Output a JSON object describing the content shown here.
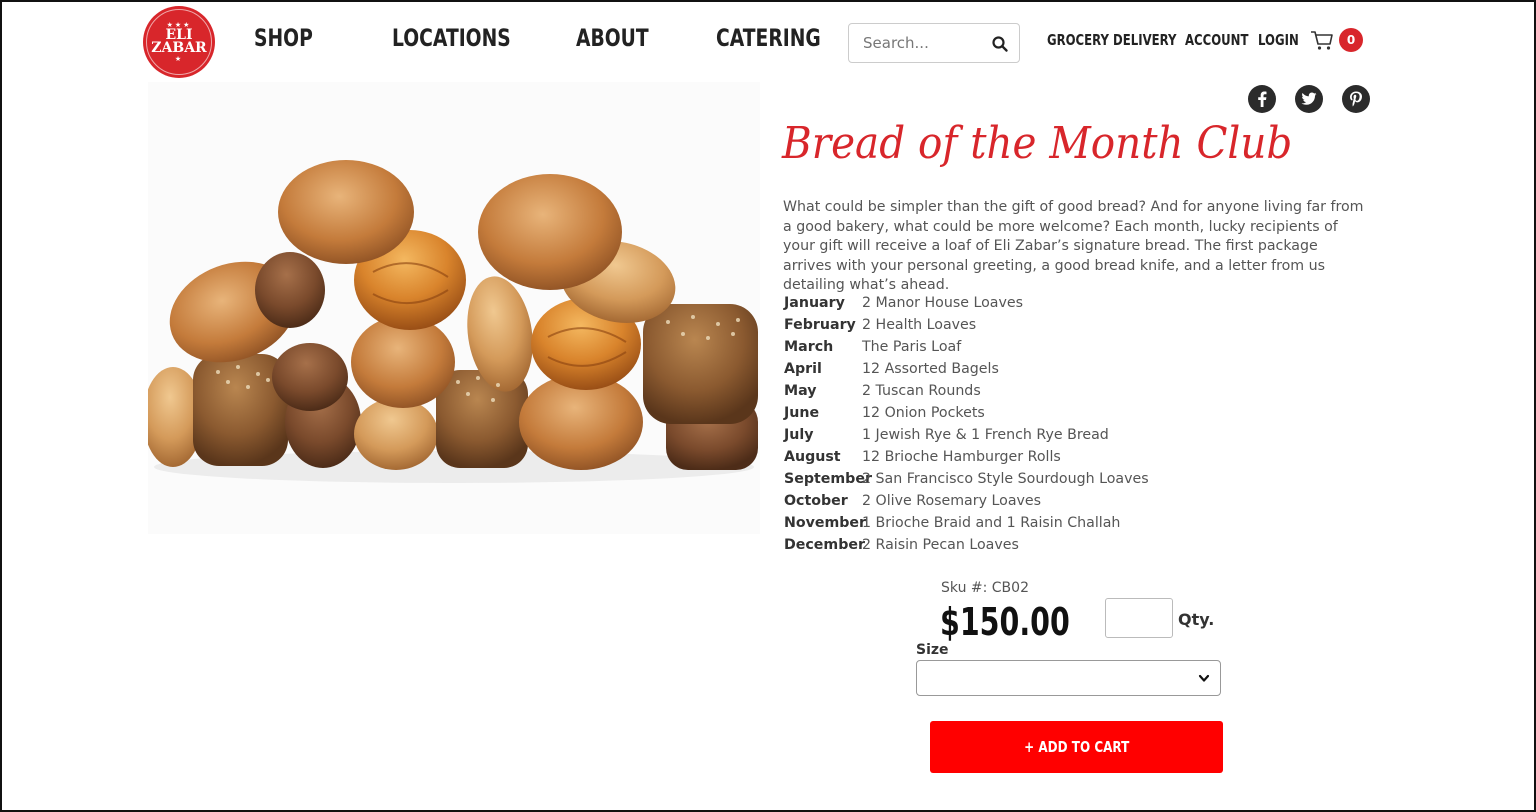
{
  "logo": {
    "text_line1": "ELI",
    "text_line2": "ZABAR",
    "stars": "★★★",
    "star_bottom": "★"
  },
  "nav": [
    {
      "label": "SHOP"
    },
    {
      "label": "LOCATIONS"
    },
    {
      "label": "ABOUT"
    },
    {
      "label": "CATERING"
    }
  ],
  "search": {
    "placeholder": "Search...",
    "icon": "search-icon"
  },
  "top_links": [
    {
      "label": "GROCERY DELIVERY"
    },
    {
      "label": "ACCOUNT"
    },
    {
      "label": "LOGIN"
    }
  ],
  "cart": {
    "count": "0",
    "icon": "cart-icon"
  },
  "social": [
    "facebook-icon",
    "twitter-icon",
    "pinterest-icon"
  ],
  "product": {
    "title": "Bread of the Month Club",
    "description": "What could be simpler than the gift of good bread? And for anyone living far from a good bakery, what could be more welcome? Each month, lucky recipients of your gift will receive a loaf of Eli Zabar’s signature bread. The first package arrives with your personal greeting, a good bread knife, and a letter from us detailing what’s ahead.",
    "schedule": [
      {
        "month": "January",
        "item": "2 Manor House Loaves"
      },
      {
        "month": "February",
        "item": "2 Health Loaves"
      },
      {
        "month": "March",
        "item": "The Paris Loaf"
      },
      {
        "month": "April",
        "item": "12 Assorted Bagels"
      },
      {
        "month": "May",
        "item": "2 Tuscan Rounds"
      },
      {
        "month": "June",
        "item": "12 Onion Pockets"
      },
      {
        "month": "July",
        "item": "1 Jewish Rye & 1 French Rye Bread"
      },
      {
        "month": "August",
        "item": "12 Brioche Hamburger Rolls"
      },
      {
        "month": "September",
        "item": "2 San Francisco Style Sourdough Loaves"
      },
      {
        "month": "October",
        "item": "2 Olive Rosemary Loaves"
      },
      {
        "month": "November",
        "item": "1 Brioche Braid and 1 Raisin Challah"
      },
      {
        "month": "December",
        "item": "2 Raisin Pecan Loaves"
      }
    ],
    "sku": "Sku #: CB02",
    "price": "$150.00",
    "qty_label": "Qty.",
    "qty_value": "",
    "size_label": "Size",
    "size_value": "",
    "add_to_cart": "+ ADD TO CART"
  },
  "colors": {
    "brand_red": "#d8262b",
    "button_red": "#ff0000"
  }
}
